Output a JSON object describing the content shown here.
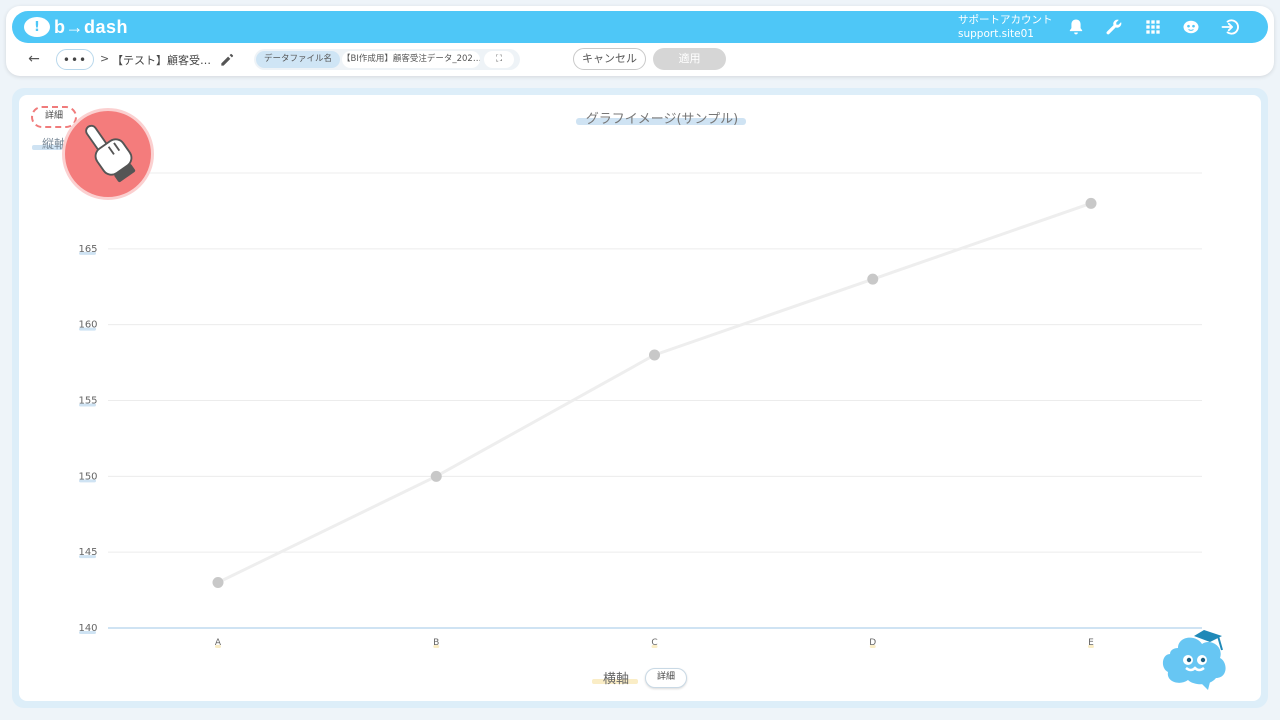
{
  "app": {
    "logo_mark": "!",
    "logo_text": "b→dash",
    "account_name": "サポートアカウント",
    "account_id": "support.site01",
    "accent_color": "#4ec7f7"
  },
  "header_icons": [
    "bell-icon",
    "wrench-icon",
    "grid-icon",
    "mascot-icon",
    "logout-icon"
  ],
  "toolbar": {
    "back": "←",
    "more": "•••",
    "separator": ">",
    "breadcrumb_title": "【テスト】顧客受…",
    "file_label": "データファイル名",
    "file_name": "【BI作成用】顧客受注データ_202…",
    "expand": "⛶",
    "cancel_label": "キャンセル",
    "apply_label": "適用"
  },
  "chart_panel": {
    "detail_label": "詳細",
    "y_axis_label": "縦軸",
    "x_axis_label": "横軸",
    "x_detail_label": "詳細"
  },
  "chart_data": {
    "type": "line",
    "title": "グラフイメージ(サンプル)",
    "xlabel": "横軸",
    "ylabel": "縦軸",
    "categories": [
      "A",
      "B",
      "C",
      "D",
      "E"
    ],
    "values": [
      143,
      150,
      158,
      163,
      168
    ],
    "ylim": [
      140,
      170
    ],
    "yticks": [
      140,
      145,
      150,
      155,
      160,
      165
    ],
    "grid": true,
    "line_color": "#eeeeee",
    "point_color": "#c8c8c8"
  }
}
